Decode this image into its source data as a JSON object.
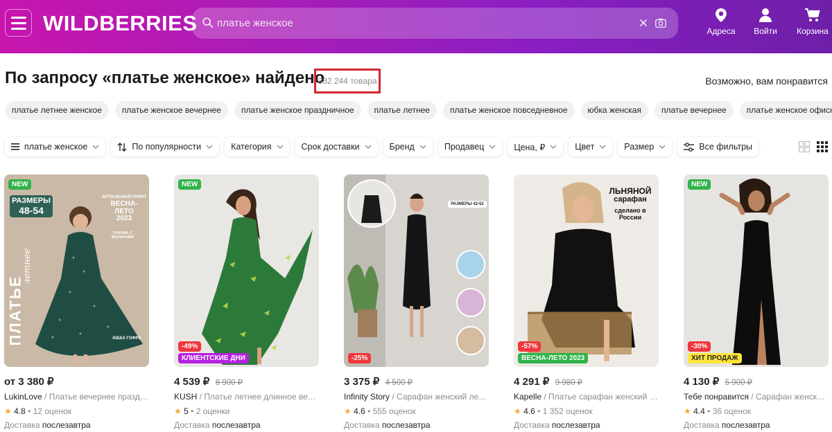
{
  "header": {
    "logo": "WILDBERRIES",
    "search_value": "платье женское",
    "addresses_label": "Адреса",
    "login_label": "Войти",
    "cart_label": "Корзина"
  },
  "results": {
    "title": "По запросу «платье женское» найдено",
    "count": "332 244 товара",
    "maybe_like": "Возможно, вам понравится"
  },
  "suggestions": [
    "платье летнее женское",
    "платье женское вечернее",
    "платье женское праздничное",
    "платье летнее",
    "платье женское повседневное",
    "юбка женская",
    "платье вечернее",
    "платье женское офисное"
  ],
  "filters": {
    "query_chip": "платье женское",
    "sort": "По популярности",
    "category": "Категория",
    "delivery": "Срок доставки",
    "brand": "Бренд",
    "seller": "Продавец",
    "price": "Цена, ₽",
    "color": "Цвет",
    "size": "Размер",
    "all_filters": "Все фильтры"
  },
  "products": [
    {
      "badge_new": "NEW",
      "discount": "",
      "promo": "",
      "price": "от 3 380 ₽",
      "old_price": "",
      "brand": "LukinLove",
      "name": " / Платье вечернее праздни...",
      "rating": "4.8",
      "reviews": "12 оценок",
      "delivery_prefix": "Доставка ",
      "delivery": "послезавтра",
      "overlay": {
        "sizes_label": "РАЗМЕРЫ",
        "sizes_value": "48-54",
        "print_label": "АКТУАЛЬНЫЙ ПРИНТ",
        "season": "ВЕСНА-ЛЕТО",
        "year": "2023",
        "sleeves": "РУКАВА С ВОЛАНАМИ",
        "vertical": "ПЛАТЬЕ",
        "script": "летнее",
        "skirt": "ЮБКА ГОФРЕ"
      }
    },
    {
      "badge_new": "NEW",
      "discount": "-49%",
      "promo": "КЛИЕНТСКИЕ ДНИ",
      "price": "4 539 ₽",
      "old_price": "8 900 ₽",
      "brand": "KUSH",
      "name": " / Платье летнее длинное вечер...",
      "rating": "5",
      "reviews": "2 оценки",
      "delivery_prefix": "Доставка ",
      "delivery": "послезавтра"
    },
    {
      "badge_new": "",
      "discount": "-25%",
      "promo": "",
      "price": "3 375 ₽",
      "old_price": "4 500 ₽",
      "brand": "Infinity Story",
      "name": " / Сарафан женский летн...",
      "rating": "4.6",
      "reviews": "555 оценок",
      "delivery_prefix": "Доставка ",
      "delivery": "послезавтра",
      "overlay": {
        "sizes": "РАЗМЕРЫ 42-52"
      }
    },
    {
      "badge_new": "",
      "discount": "-57%",
      "promo": "ВЕСНА-ЛЕТО 2023",
      "price": "4 291 ₽",
      "old_price": "9 980 ₽",
      "brand": "Kapelle",
      "name": " / Платье сарафан женский ле...",
      "rating": "4.6",
      "reviews": "1 352 оценок",
      "delivery_prefix": "Доставка ",
      "delivery": "послезавтра",
      "overlay": {
        "line1": "ЛЬНЯНОЙ",
        "line2": "сарафан",
        "line3": "сделано в",
        "line4": "России"
      }
    },
    {
      "badge_new": "NEW",
      "discount": "-30%",
      "promo": "ХИТ ПРОДАЖ",
      "price": "4 130 ₽",
      "old_price": "5 900 ₽",
      "brand": "Тебе понравится",
      "name": " / Сарафан женский ...",
      "rating": "4.4",
      "reviews": "36 оценок",
      "delivery_prefix": "Доставка ",
      "delivery": "послезавтра"
    }
  ],
  "colors": {
    "header_start": "#c615ad",
    "header_end": "#6e1fa8",
    "highlight_box": "#d0272e",
    "badge_new": "#2fb34a",
    "badge_discount": "#f0373d",
    "promo_clients": "#b620e0",
    "promo_spring": "#2fb34a",
    "promo_hit": "#ffe53b",
    "star": "#f2a93b"
  },
  "icons": [
    "menu-icon",
    "search-icon",
    "clear-icon",
    "camera-icon",
    "location-pin-icon",
    "user-icon",
    "cart-icon",
    "list-icon",
    "sort-icon",
    "chevron-down-icon",
    "filter-settings-icon",
    "grid-large-icon",
    "grid-small-icon",
    "star-icon"
  ]
}
